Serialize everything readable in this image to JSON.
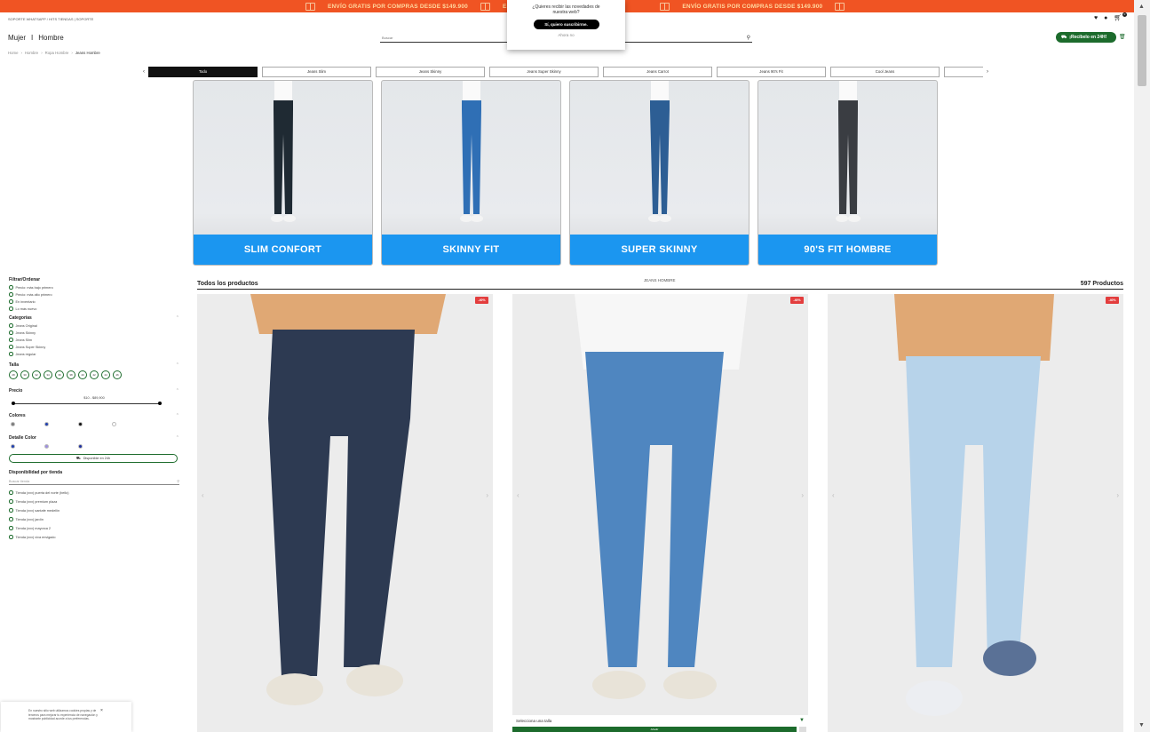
{
  "promo": {
    "messages": [
      "ENVÍO GRATIS POR COMPRAS DESDE $149.900",
      "EN",
      "ENVÍO GRATIS POR COMPRAS DESDE $149.900"
    ],
    "color": "#f05423"
  },
  "popup": {
    "question": "¿Quieres recibir las novedades de nuestra web?",
    "accept_label": "Sí, quiero suscribirme.",
    "later_label": "Ahora no"
  },
  "utility_text": "SOPORTE WHATSAPP / HITS TIENDAS  |  SOPORTE",
  "header": {
    "gender_women": "Mujer",
    "gender_sep": "I",
    "gender_men": "Hombre",
    "search_placeholder": "Buscar",
    "pill_label": "¡Recíbelo en 24H!",
    "cart_count": "0",
    "icons": [
      "heart-icon",
      "user-icon",
      "cart-icon",
      "search-icon",
      "trash-icon"
    ]
  },
  "breadcrumb": {
    "items": [
      "Home",
      "Hombre",
      "Ropa Hombre",
      "Jeans Hombre"
    ]
  },
  "tabs": [
    "Todo",
    "Jeans Slim",
    "Jeans Skinny",
    "Jeans Super Skinny",
    "Jeans Carrot",
    "Jeans 90's Fit",
    "Cool Jeans",
    ""
  ],
  "fits": [
    {
      "label": "SLIM CONFORT",
      "color": "#1f2a33"
    },
    {
      "label": "SKINNY FIT",
      "color": "#2f6fb5"
    },
    {
      "label": "SUPER SKINNY",
      "color": "#2d5e94"
    },
    {
      "label": "90'S FIT HOMBRE",
      "color": "#3a3d42"
    }
  ],
  "filters": {
    "title": "Filtrar/Ordenar",
    "sort": [
      "Precio: más bajo primero",
      "Precio: más alto primero",
      "En inventario",
      "Lo más nuevo"
    ],
    "categories_title": "Categorías",
    "categories": [
      "Jeans Original",
      "Jeans Skinny",
      "Jeans Slim",
      "Jeans Super Skinny",
      "Jeans regular"
    ],
    "size_title": "Talla",
    "sizes": [
      "28",
      "30",
      "32",
      "34",
      "36",
      "38",
      "40",
      "42",
      "44",
      "46"
    ],
    "price_title": "Precio",
    "price_range": "$10 - $89,900",
    "colors_title": "Colores",
    "colors": [
      "#7a7a7a",
      "#1f3fb0",
      "#111111",
      "#ffffff"
    ],
    "detail_color_title": "Detalle Color",
    "detail_colors": [
      "#1f3fb0",
      "#9d8fe0",
      "#1e2fa0"
    ],
    "available_24h": "Disponible en 24h",
    "stores_title": "Disponibilidad por tienda",
    "store_search_placeholder": "Buscar tienda",
    "stores": [
      "Tienda (xxx) puerta del norte (bello)",
      "Tienda (xxx) premium plaza",
      "Tienda (xxx) santafe medellín",
      "Tienda (xxx) jardín",
      "Tienda (xxx) mayorca 2",
      "Tienda (xxx) viva envigado"
    ]
  },
  "listing": {
    "all_products": "Todos los productos",
    "category": "JEANS HOMBRE",
    "count": "597 Productos"
  },
  "products": [
    {
      "badge": "-40%",
      "color": "#2d3a52"
    },
    {
      "badge": "-40%",
      "color": "#4f86c0"
    },
    {
      "badge": "-40%",
      "color": "#b7d3ea"
    }
  ],
  "size_select": "Selecciona una talla",
  "add_label": "Añadir",
  "cookie": {
    "text": "En nuestro sitio web utilizamos cookies propias y de terceros para mejorar tu experiencia de navegación y mostrarte publicidad acorde a tus preferencias."
  }
}
